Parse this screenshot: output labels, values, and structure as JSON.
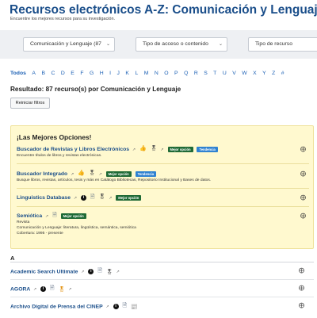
{
  "header": {
    "title": "Recursos electrónicos A-Z: Comunicación y Lenguaje",
    "subtitle": "Encuentre los mejores recursos para su investigación."
  },
  "filters": {
    "subject": "Comunicación y Lenguaje (87",
    "access": "Tipo de acceso o contenido",
    "resource_type": "Tipo de recurso"
  },
  "alphabet": [
    "Todos",
    "A",
    "B",
    "C",
    "D",
    "E",
    "F",
    "G",
    "H",
    "I",
    "J",
    "K",
    "L",
    "M",
    "N",
    "O",
    "P",
    "Q",
    "R",
    "S",
    "T",
    "U",
    "V",
    "W",
    "X",
    "Y",
    "Z",
    "#"
  ],
  "results": {
    "summary": "Resultado: 87 recurso(s) por Comunicación y Lenguaje",
    "reset_label": "Reiniciar filtros"
  },
  "best": {
    "title": "¡Las Mejores Opciones!",
    "badge_best": "Mejor opción",
    "badge_trend": "Tendencia",
    "items": [
      {
        "name": "Buscador de Revistas y Libros Electrónicos",
        "desc": "Encuentre títulos de libros y revistas electrónicas."
      },
      {
        "name": "Buscador Integrado",
        "desc": "Busque libros, revistas, artículos, tesis y más en Catálogo Bibliotecas, Repositorio Institucional y Bases de datos."
      },
      {
        "name": "Linguistics Database",
        "desc": ""
      },
      {
        "name": "Semiótica",
        "desc_lines": [
          "Revista",
          "Comunicación y Lenguaje: literatura, lingüística, semántica, semiótica",
          "Cobertura: 1995 - presente"
        ]
      }
    ]
  },
  "list": {
    "letter": "A",
    "items": [
      {
        "name": "Academic Search Ultimate"
      },
      {
        "name": "AGORA"
      },
      {
        "name": "Archivo Digital de Prensa del CINEP"
      }
    ]
  },
  "icons": {
    "share": "share-icon",
    "external": "external-link-icon",
    "info": "info-icon"
  },
  "colors": {
    "title": "#1a4e8a",
    "link": "#1a5fb4",
    "best_bg": "#fff9cf",
    "badge_green": "#1f6a36",
    "badge_blue": "#2f82d1"
  }
}
